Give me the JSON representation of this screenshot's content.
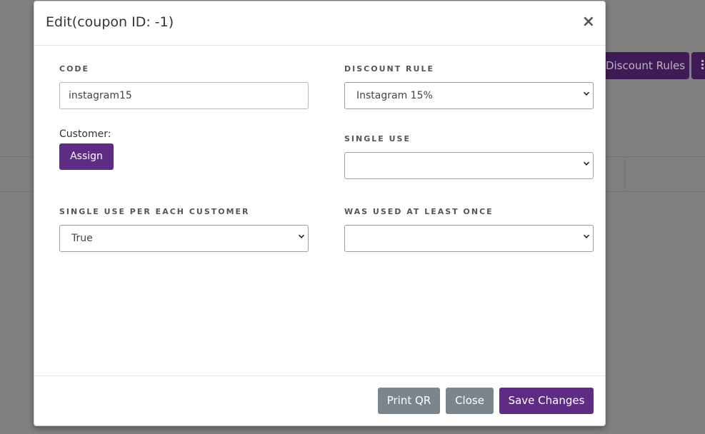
{
  "background": {
    "discount_rules_button": "Discount Rules"
  },
  "modal": {
    "title": "Edit(coupon ID: -1)",
    "close_symbol": "×",
    "code": {
      "label": "CODE",
      "value": "instagram15"
    },
    "discount_rule": {
      "label": "DISCOUNT RULE",
      "selected": "Instagram 15%"
    },
    "customer": {
      "label": "Customer:",
      "assign_button": "Assign"
    },
    "single_use": {
      "label": "SINGLE USE",
      "selected": ""
    },
    "single_use_per_customer": {
      "label": "SINGLE USE PER EACH CUSTOMER",
      "selected": "True"
    },
    "was_used_at_least_once": {
      "label": "WAS USED AT LEAST ONCE",
      "selected": ""
    },
    "footer": {
      "print_qr": "Print QR",
      "close": "Close",
      "save_changes": "Save Changes"
    }
  },
  "colors": {
    "primary": "#5e2b85",
    "secondary": "#7d858c",
    "overlay": "#808080"
  },
  "icons": [
    "close-icon",
    "chevron-down-icon",
    "more-options-icon"
  ]
}
